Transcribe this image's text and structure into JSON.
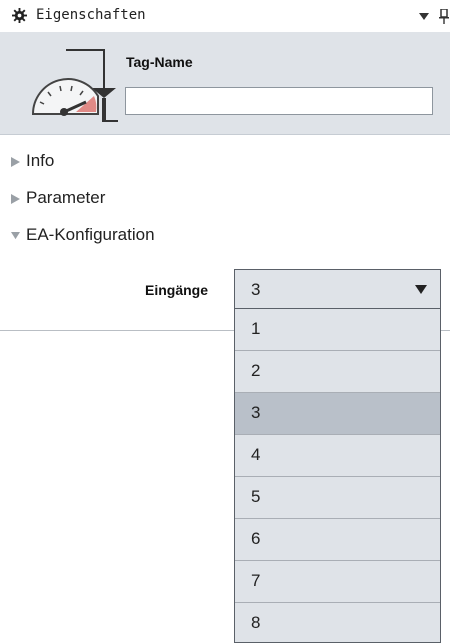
{
  "window": {
    "title": "Eigenschaften"
  },
  "header": {
    "tag_label": "Tag-Name",
    "tag_value": ""
  },
  "sections": [
    {
      "label": "Info",
      "expanded": false
    },
    {
      "label": "Parameter",
      "expanded": false
    },
    {
      "label": "EA-Konfiguration",
      "expanded": true
    }
  ],
  "ea_config": {
    "inputs_label": "Eingänge",
    "selected_value": "3",
    "options": [
      "1",
      "2",
      "3",
      "4",
      "5",
      "6",
      "7",
      "8"
    ],
    "highlighted_option": "3"
  },
  "colors": {
    "panel_background": "#dfe3e8",
    "selected_option": "#b9c0c9"
  },
  "icons": {
    "title": "gear-icon",
    "header": "gauge-icon",
    "collapsed": "triangle-right-icon",
    "expanded": "triangle-down-icon",
    "dropdown": "triangle-down-icon",
    "pin": "pin-icon"
  }
}
